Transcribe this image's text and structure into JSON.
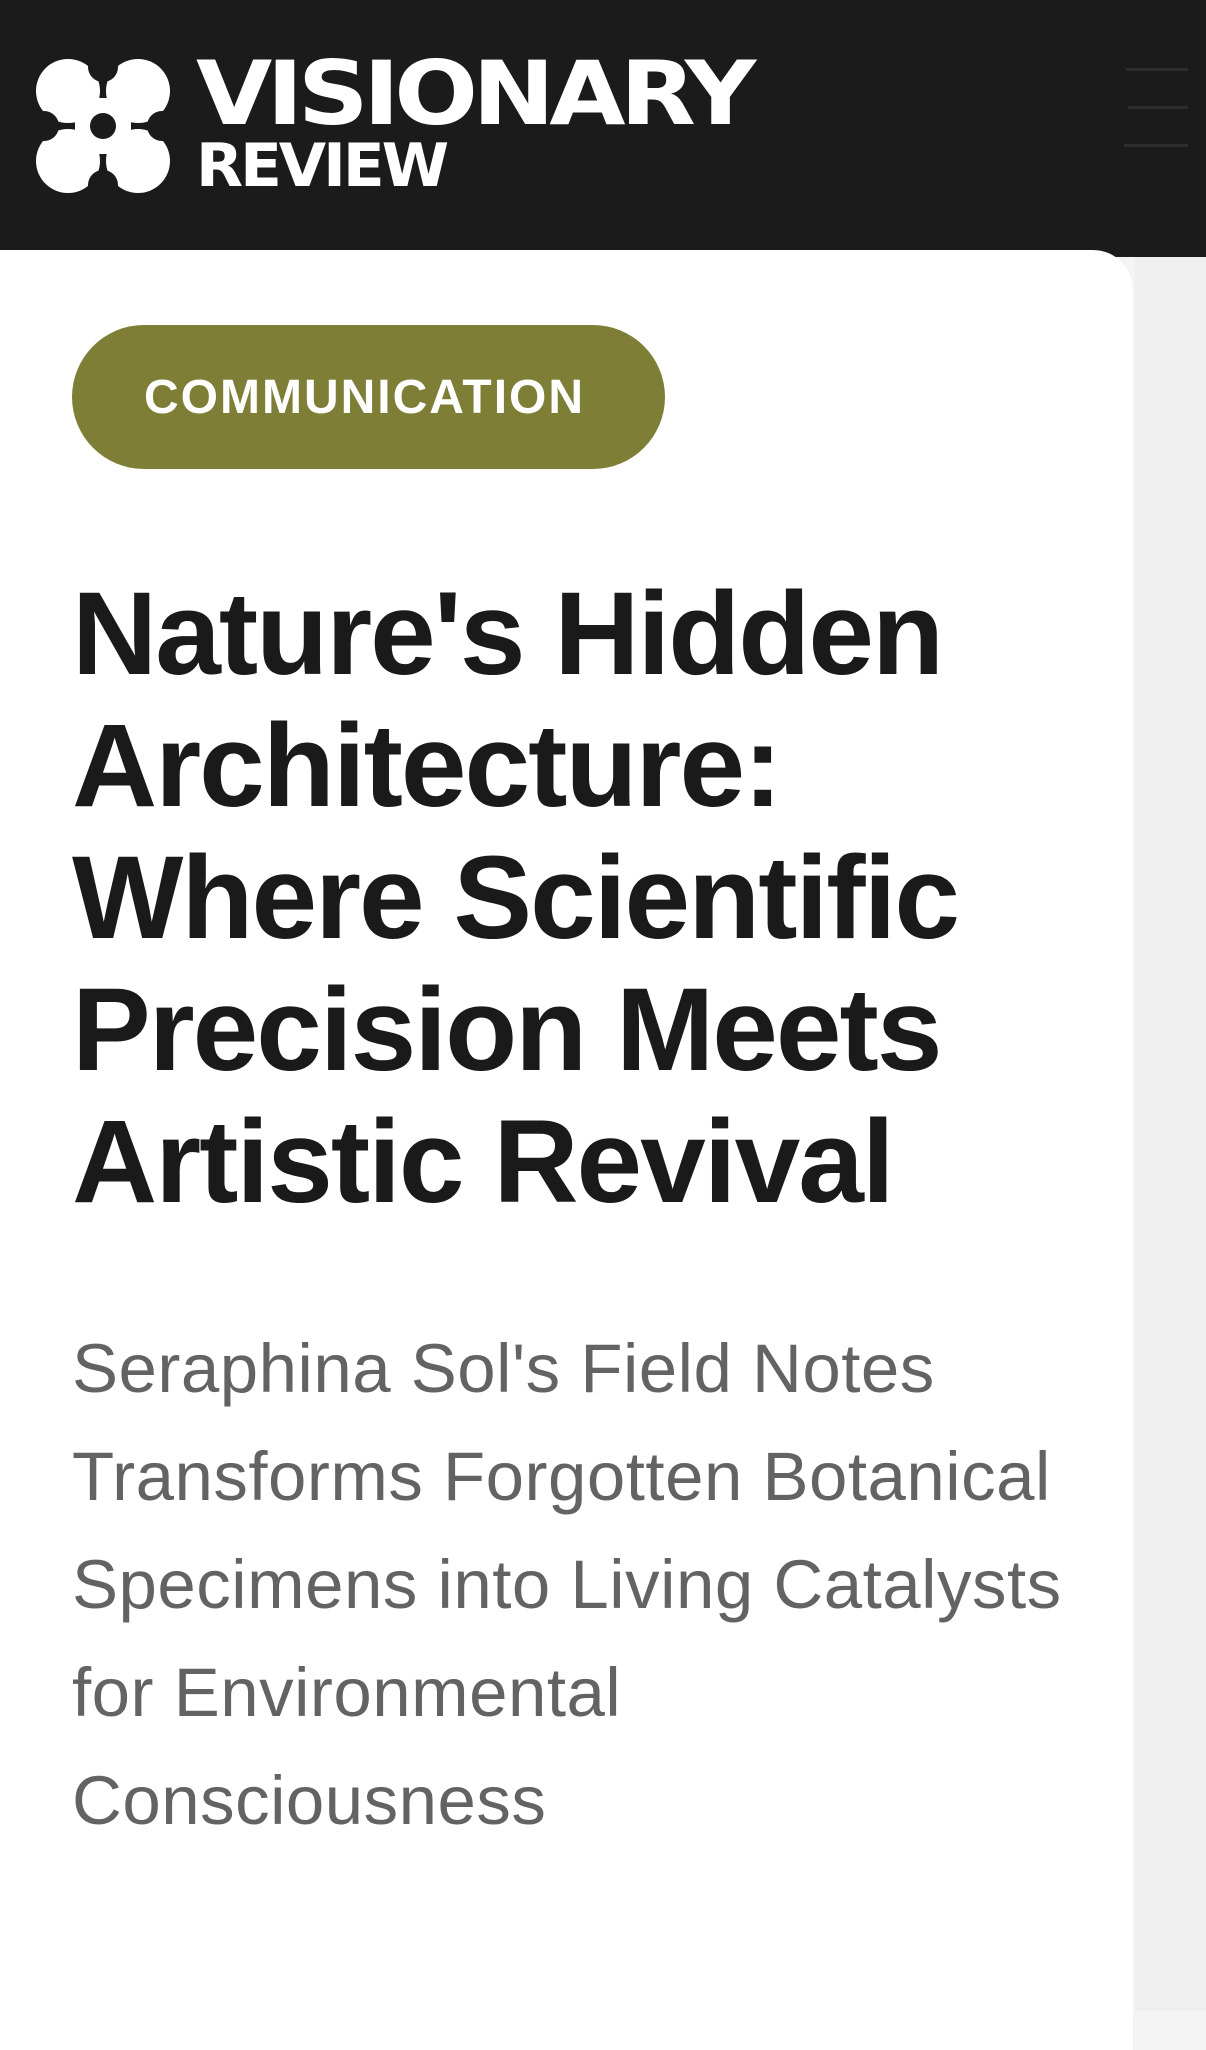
{
  "header": {
    "brand_line1": "VISIONARY",
    "brand_line2": "REVIEW",
    "logo_icon": "four-dot-clover-logo",
    "menu_icon": "hamburger-menu-icon",
    "background_color": "#1c1b1b"
  },
  "article": {
    "category": "COMMUNICATION",
    "category_color": "#7f7e36",
    "headline": "Nature's Hidden Architecture: Where Scientific Precision Meets Artistic Revival",
    "dek": "Seraphina Sol's Field Notes Transforms Forgotten Botanical Specimens into Living Catalysts for Environmental Consciousness"
  }
}
